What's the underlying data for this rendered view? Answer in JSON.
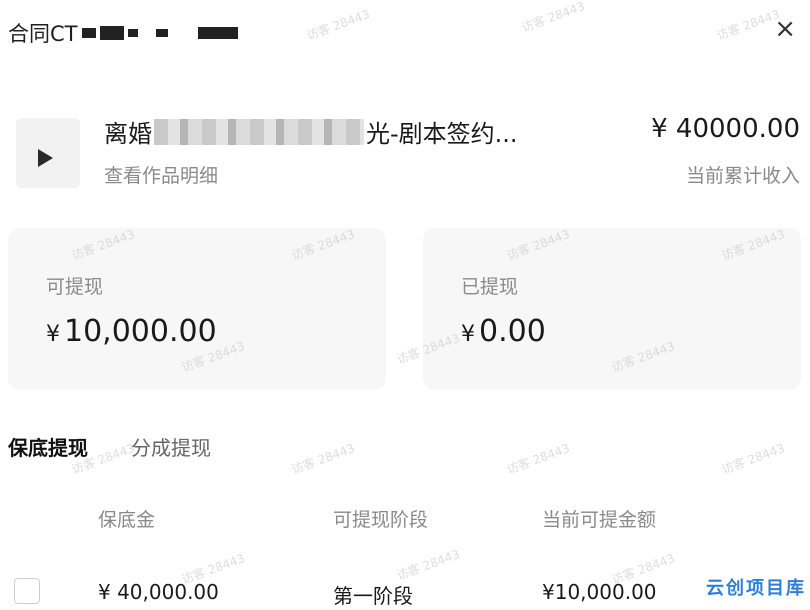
{
  "header": {
    "title_prefix": "合同CT",
    "close_symbol": "×"
  },
  "work": {
    "title_prefix": "离婚",
    "title_suffix": "光-剧本签约...",
    "details_link": "查看作品明细",
    "total_income_amount": "¥ 40000.00",
    "total_income_label": "当前累计收入"
  },
  "balances": {
    "withdrawable": {
      "label": "可提现",
      "currency": "¥",
      "amount": "10,000.00"
    },
    "withdrawn": {
      "label": "已提现",
      "currency": "¥",
      "amount": "0.00"
    }
  },
  "tabs": [
    {
      "label": "保底提现",
      "active": true
    },
    {
      "label": "分成提现",
      "active": false
    }
  ],
  "table": {
    "headers": [
      "保底金",
      "可提现阶段",
      "当前可提金额"
    ],
    "rows": [
      {
        "guarantee": "¥ 40,000.00",
        "stage": "第一阶段",
        "available": "¥10,000.00"
      }
    ]
  },
  "watermark": {
    "text": "访客 28443",
    "corner_brand": "云创项目库"
  },
  "colors": {
    "card_bg": "#f7f7f7",
    "muted_text": "#8a8a8a",
    "brand_blue": "#2f7fd8"
  }
}
